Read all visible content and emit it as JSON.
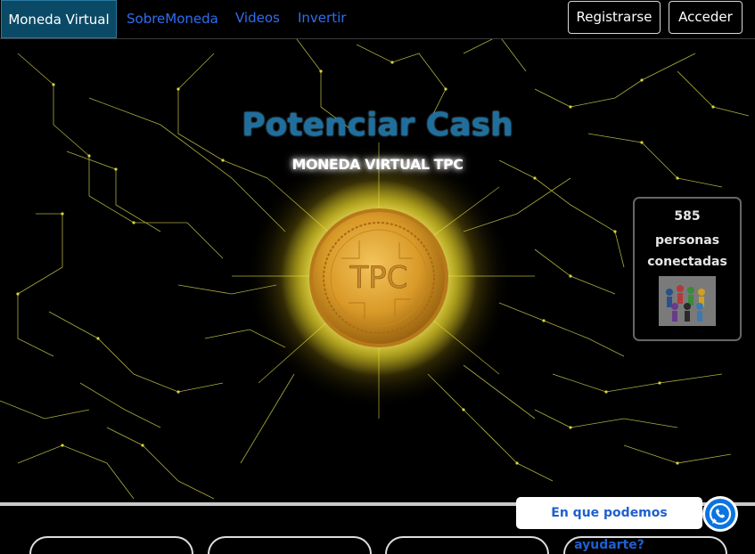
{
  "navbar": {
    "brand": "Moneda Virtual",
    "links": [
      "SobreMoneda",
      "Videos",
      "Invertir"
    ],
    "register_label": "Registrarse",
    "login_label": "Acceder"
  },
  "hero": {
    "title": "Potenciar Cash",
    "subtitle": "MONEDA VIRTUAL TPC",
    "coin_text": "TPC"
  },
  "connected": {
    "count": "585",
    "label": "personas conectadas"
  },
  "help": {
    "bubble_text": "En que podemos ayudarte?"
  },
  "colors": {
    "accent_link": "#2f6df0",
    "brand_bg": "#0b4a66",
    "circuit": "#e8e63a",
    "coin_gold": "#d9a42c"
  },
  "icons": {
    "whatsapp": "whatsapp-icon",
    "people": "people-group-icon"
  }
}
